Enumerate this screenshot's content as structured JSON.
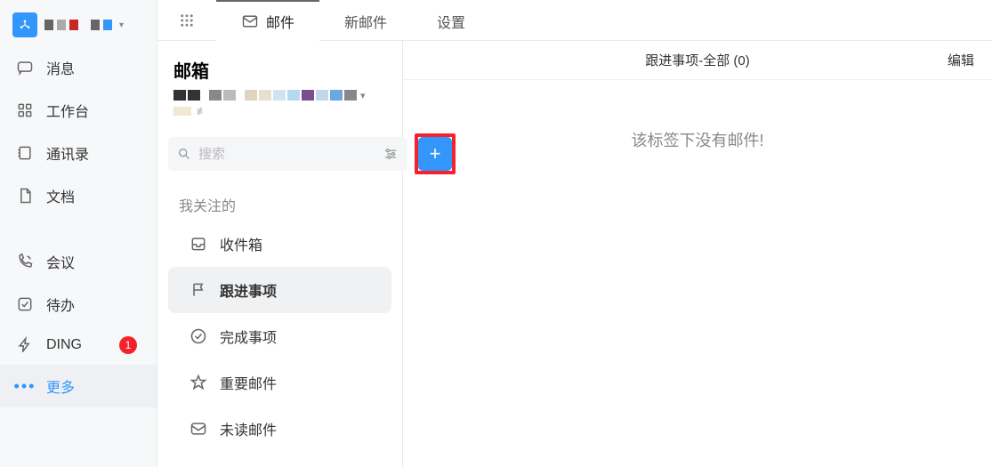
{
  "nav": {
    "items": [
      {
        "label": "消息"
      },
      {
        "label": "工作台"
      },
      {
        "label": "通讯录"
      },
      {
        "label": "文档"
      },
      {
        "label": "会议"
      },
      {
        "label": "待办"
      },
      {
        "label": "DING",
        "badge": "1"
      },
      {
        "label": "更多"
      }
    ]
  },
  "tabs": {
    "mail": "邮件",
    "newMail": "新邮件",
    "settings": "设置"
  },
  "mail": {
    "title": "邮箱",
    "search_placeholder": "搜索",
    "section_label": "我关注的",
    "folders": {
      "inbox": "收件箱",
      "followup": "跟进事项",
      "done": "完成事项",
      "important": "重要邮件",
      "unread": "未读邮件"
    }
  },
  "list": {
    "header": "跟进事项-全部 (0)",
    "edit": "编辑",
    "empty": "该标签下没有邮件!"
  }
}
